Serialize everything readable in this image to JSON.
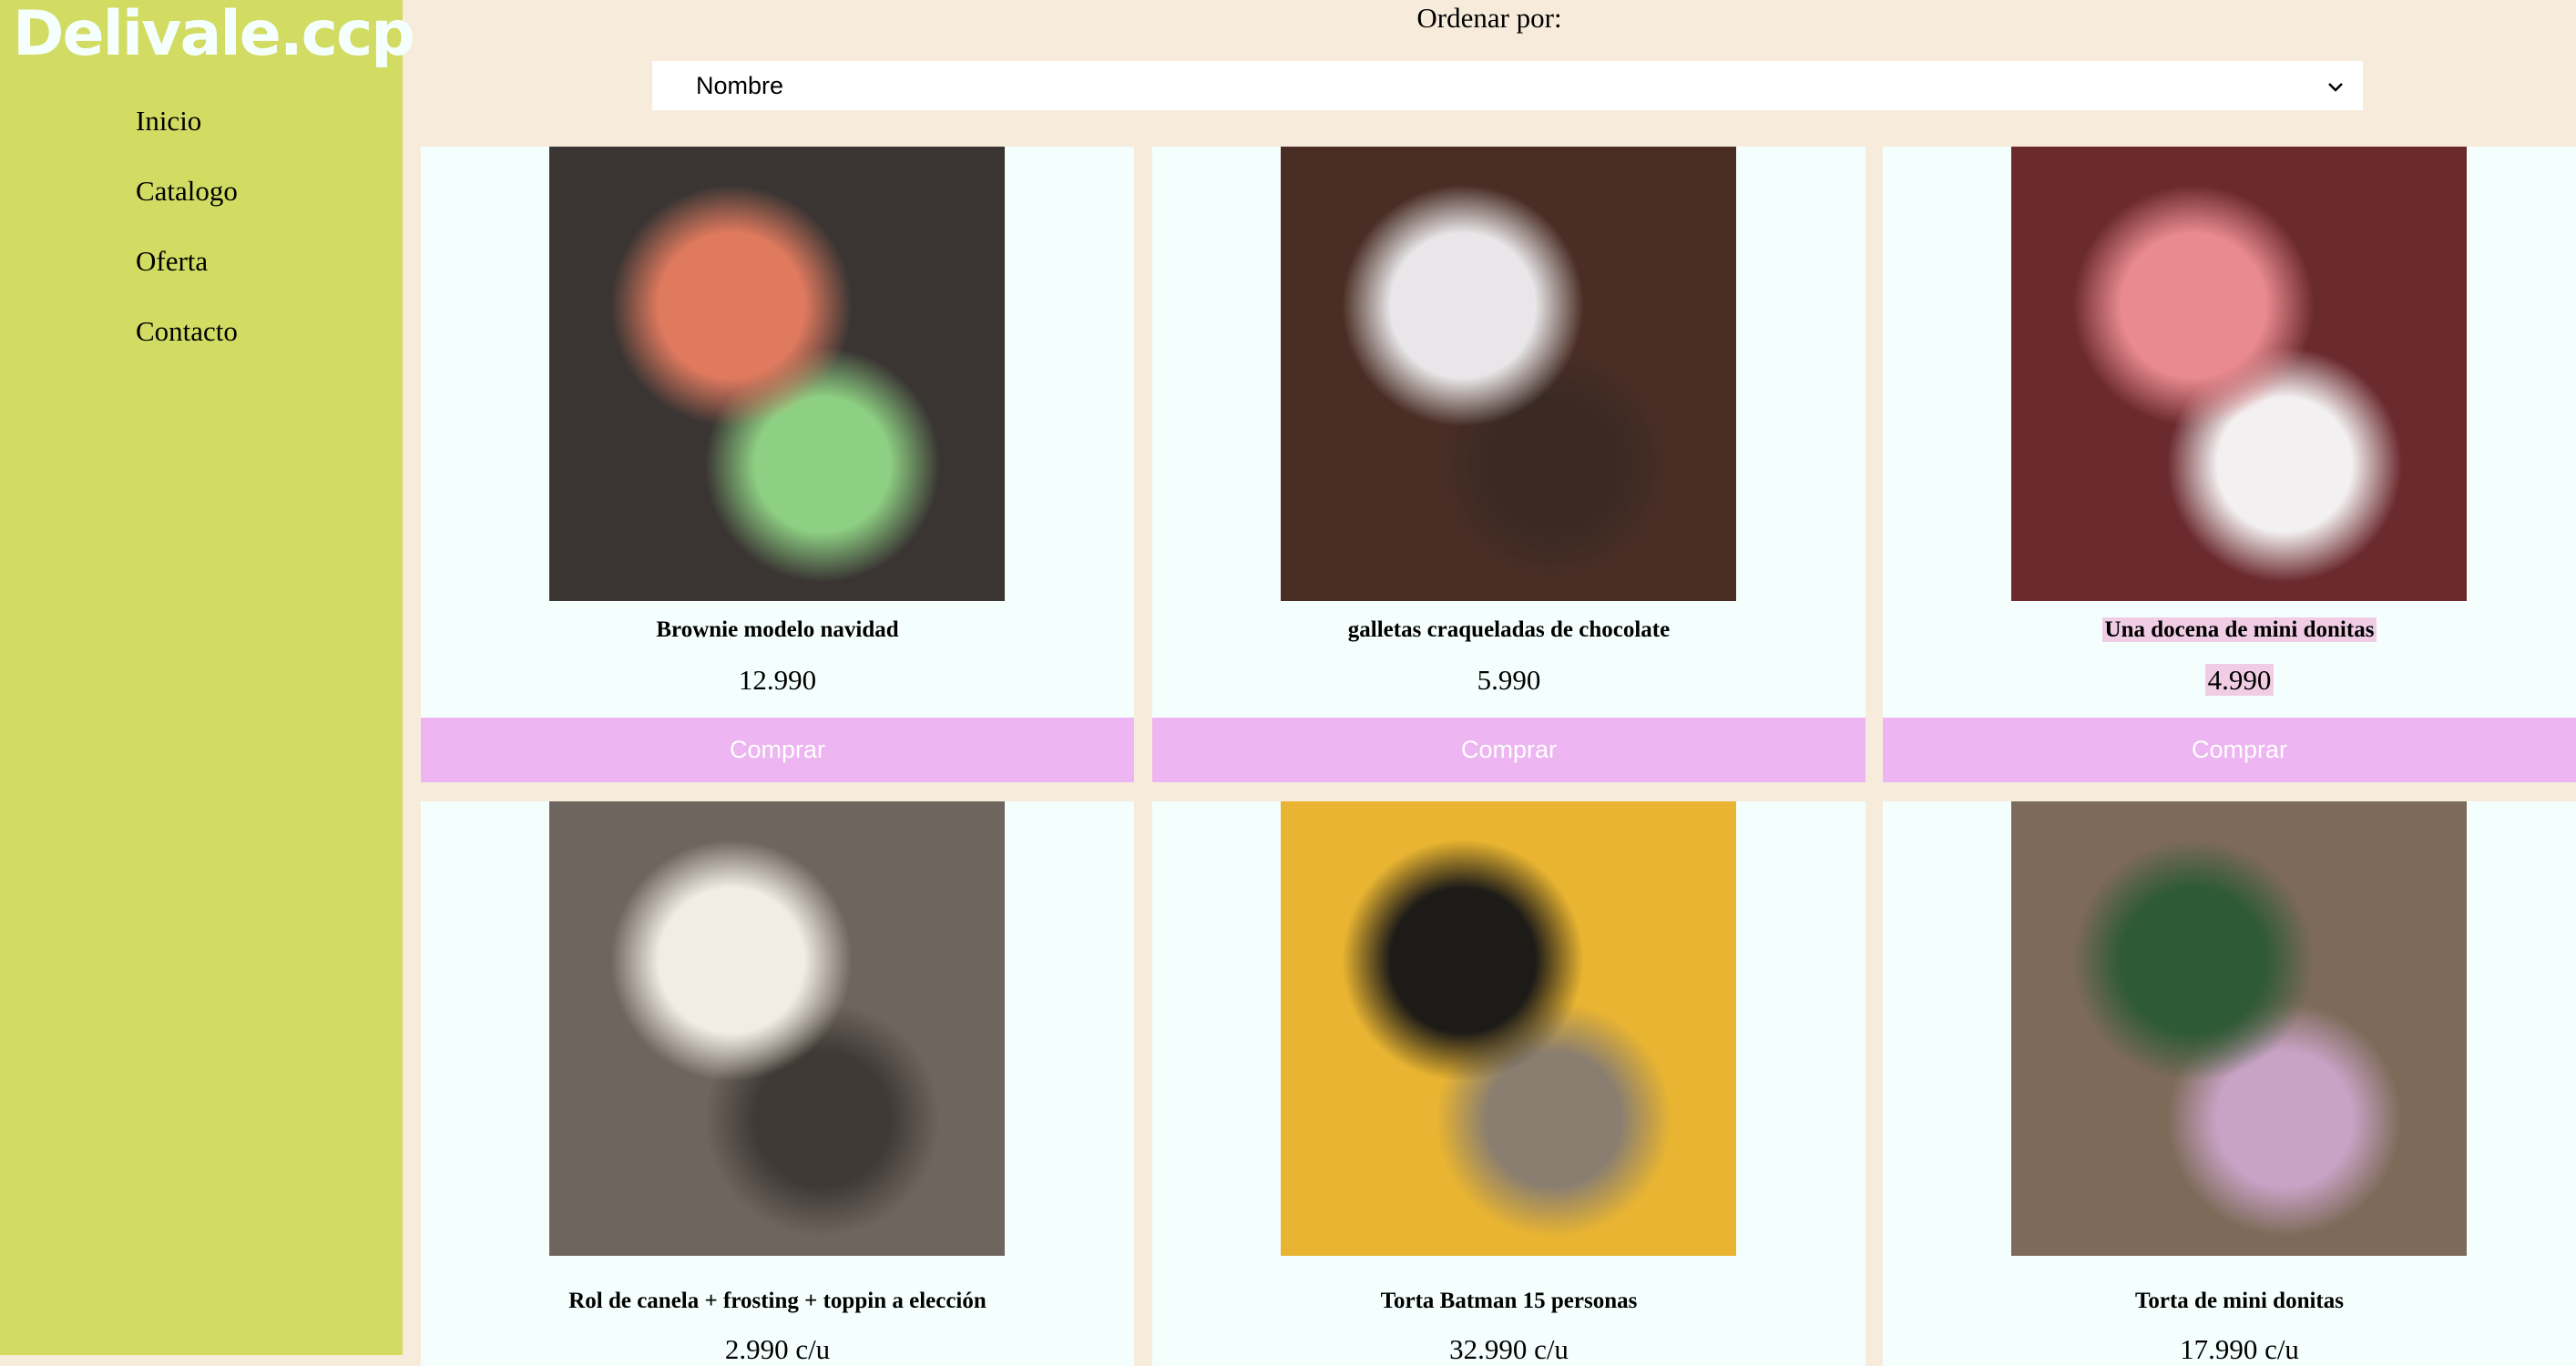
{
  "brand": "Delivale.ccp",
  "nav": [
    "Inicio",
    "Catalogo",
    "Oferta",
    "Contacto"
  ],
  "sort": {
    "label": "Ordenar por:",
    "selected": "Nombre"
  },
  "products": [
    {
      "name": "Brownie modelo navidad",
      "price": "12.990",
      "button": "Comprar",
      "colors": [
        "#3a3533",
        "#e07a5f",
        "#8ed083"
      ]
    },
    {
      "name": "galletas craqueladas de chocolate",
      "price": "5.990",
      "button": "Comprar",
      "colors": [
        "#4a2e25",
        "#e8e6e8",
        "#3b2a24"
      ]
    },
    {
      "name": "Una docena de mini donitas",
      "price": "4.990",
      "button": "Comprar",
      "colors": [
        "#6b2a2e",
        "#e88a8f",
        "#f3f0f1"
      ]
    },
    {
      "name": "Rol de canela + frosting + toppin a elección",
      "price": "2.990 c/u",
      "colors": [
        "#6e655e",
        "#f2ede4",
        "#403934"
      ]
    },
    {
      "name": "Torta Batman 15 personas",
      "price": "32.990 c/u",
      "colors": [
        "#e8b431",
        "#1d1b18",
        "#8a7e70"
      ]
    },
    {
      "name": "Torta de mini donitas",
      "price": "17.990 c/u",
      "colors": [
        "#7d6a58",
        "#2f5a36",
        "#c9a3c6"
      ]
    }
  ]
}
